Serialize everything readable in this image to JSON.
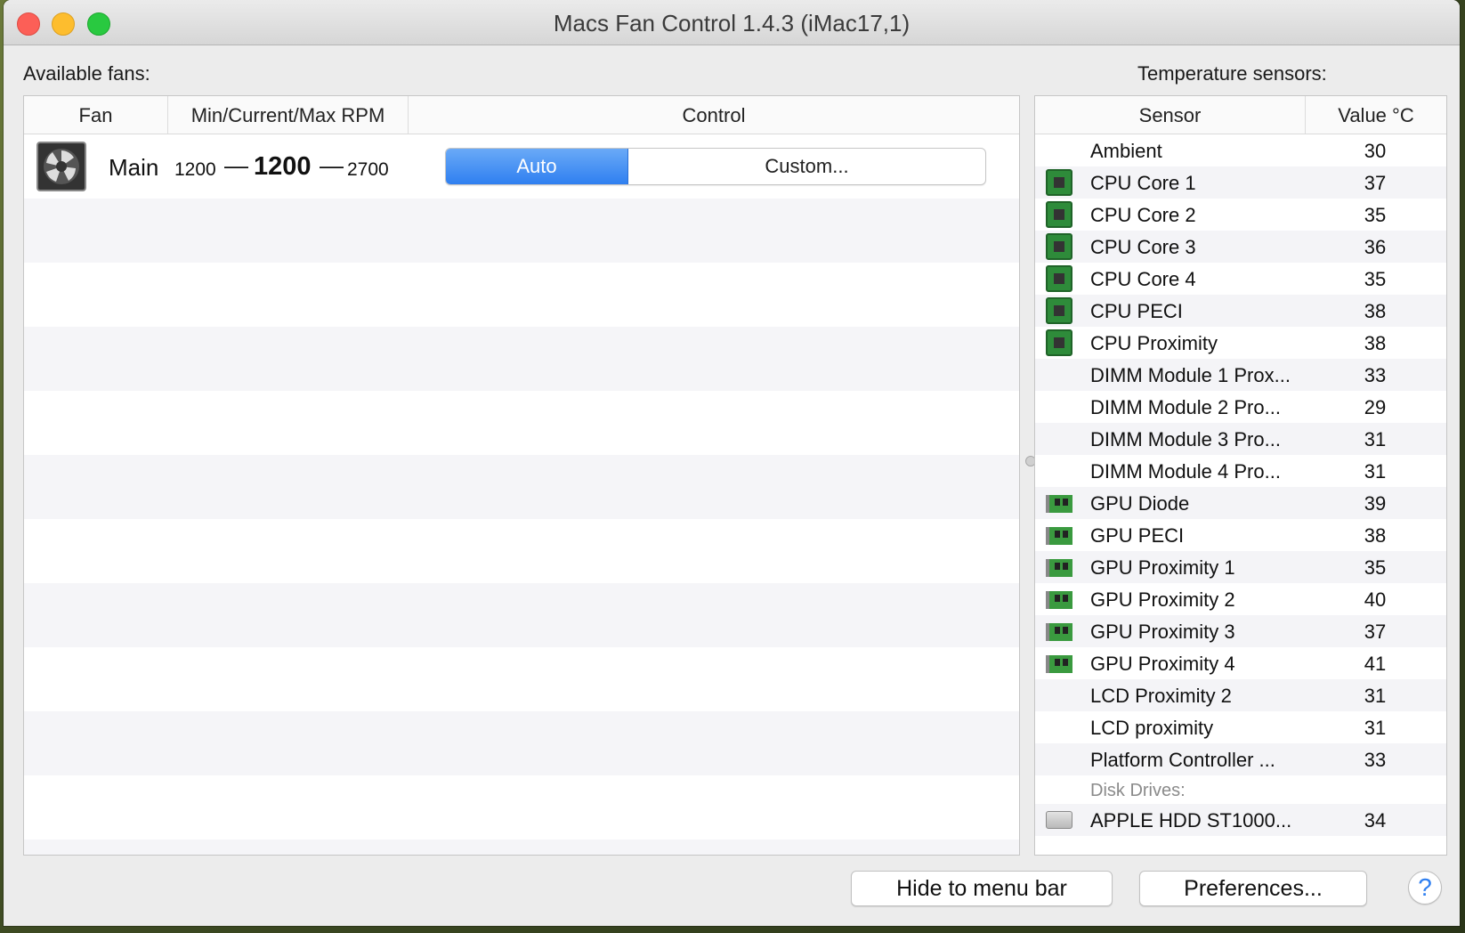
{
  "window": {
    "title": "Macs Fan Control 1.4.3 (iMac17,1)"
  },
  "fans_panel": {
    "label": "Available fans:",
    "columns": {
      "fan": "Fan",
      "rpm": "Min/Current/Max RPM",
      "control": "Control"
    },
    "fans": [
      {
        "name": "Main",
        "min": "1200",
        "current": "1200",
        "max": "2700",
        "dash": "—",
        "control": {
          "auto": "Auto",
          "custom": "Custom...",
          "selected": "Auto"
        }
      }
    ]
  },
  "sensors_panel": {
    "label": "Temperature sensors:",
    "columns": {
      "sensor": "Sensor",
      "value": "Value °C"
    },
    "rows": [
      {
        "icon": "",
        "name": "Ambient",
        "value": "30"
      },
      {
        "icon": "cpu-chip-icon",
        "name": "CPU Core 1",
        "value": "37"
      },
      {
        "icon": "cpu-chip-icon",
        "name": "CPU Core 2",
        "value": "35"
      },
      {
        "icon": "cpu-chip-icon",
        "name": "CPU Core 3",
        "value": "36"
      },
      {
        "icon": "cpu-chip-icon",
        "name": "CPU Core 4",
        "value": "35"
      },
      {
        "icon": "cpu-chip-icon",
        "name": "CPU PECI",
        "value": "38"
      },
      {
        "icon": "cpu-chip-icon",
        "name": "CPU Proximity",
        "value": "38"
      },
      {
        "icon": "",
        "name": "DIMM Module 1 Prox...",
        "value": "33"
      },
      {
        "icon": "",
        "name": "DIMM Module 2 Pro...",
        "value": "29"
      },
      {
        "icon": "",
        "name": "DIMM Module 3 Pro...",
        "value": "31"
      },
      {
        "icon": "",
        "name": "DIMM Module 4 Pro...",
        "value": "31"
      },
      {
        "icon": "gpu-card-icon",
        "name": "GPU Diode",
        "value": "39"
      },
      {
        "icon": "gpu-card-icon",
        "name": "GPU PECI",
        "value": "38"
      },
      {
        "icon": "gpu-card-icon",
        "name": "GPU Proximity 1",
        "value": "35"
      },
      {
        "icon": "gpu-card-icon",
        "name": "GPU Proximity 2",
        "value": "40"
      },
      {
        "icon": "gpu-card-icon",
        "name": "GPU Proximity 3",
        "value": "37"
      },
      {
        "icon": "gpu-card-icon",
        "name": "GPU Proximity 4",
        "value": "41"
      },
      {
        "icon": "",
        "name": "LCD Proximity 2",
        "value": "31"
      },
      {
        "icon": "",
        "name": "LCD proximity",
        "value": "31"
      },
      {
        "icon": "",
        "name": "Platform Controller ...",
        "value": "33"
      }
    ],
    "group": "Disk Drives:",
    "disk_rows": [
      {
        "icon": "hard-drive-icon",
        "name": "APPLE HDD ST1000...",
        "value": "34"
      }
    ]
  },
  "buttons": {
    "hide": "Hide to menu bar",
    "preferences": "Preferences...",
    "help": "?"
  },
  "colors": {
    "accent": "#2f7ff0",
    "close": "#fc5f57",
    "minimize": "#fdbd2e",
    "maximize": "#29c940"
  }
}
